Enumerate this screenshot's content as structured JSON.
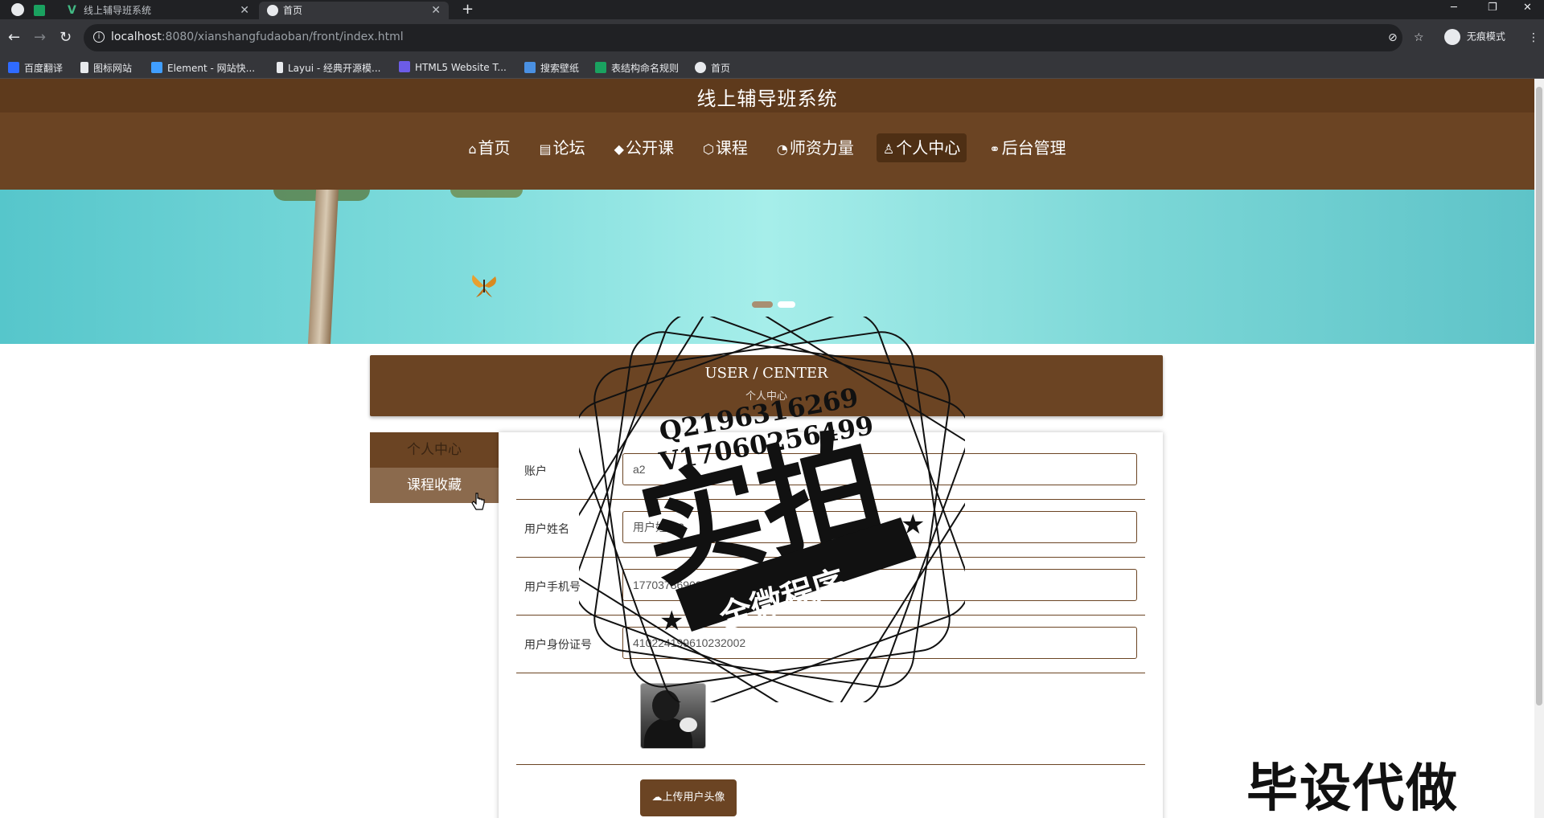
{
  "browser": {
    "tabs": [
      {
        "title": "",
        "icon": "globe-icon"
      },
      {
        "title": "",
        "icon": "sheet-icon"
      },
      {
        "title": "线上辅导班系统",
        "icon": "vue-icon"
      },
      {
        "title": "首页",
        "icon": "globe-icon"
      }
    ],
    "url_host": "localhost",
    "url_rest": ":8080/xianshangfudaoban/front/index.html",
    "incognito_label": "无痕模式",
    "bookmarks": [
      {
        "label": "百度翻译",
        "icon": "translate-icon",
        "color": "#2f6bff"
      },
      {
        "label": "图标网站",
        "icon": "flag-icon",
        "color": "#e8eaed"
      },
      {
        "label": "Element - 网站快...",
        "icon": "element-icon",
        "color": "#409eff"
      },
      {
        "label": "Layui - 经典开源模...",
        "icon": "layui-icon",
        "color": "#e8eaed"
      },
      {
        "label": "HTML5 Website T...",
        "icon": "html5-icon",
        "color": "#6c5ce7"
      },
      {
        "label": "搜索壁纸",
        "icon": "wallpaper-icon",
        "color": "#4a90e2"
      },
      {
        "label": "表结构命名规则",
        "icon": "sheet-icon",
        "color": "#1aa260"
      },
      {
        "label": "首页",
        "icon": "globe-icon",
        "color": "#e8eaed"
      }
    ]
  },
  "site": {
    "title": "线上辅导班系统",
    "nav": [
      {
        "label": "首页",
        "icon": "⌂",
        "active": false
      },
      {
        "label": "论坛",
        "icon": "▤",
        "active": false
      },
      {
        "label": "公开课",
        "icon": "◆",
        "active": false
      },
      {
        "label": "课程",
        "icon": "⬡",
        "active": false
      },
      {
        "label": "师资力量",
        "icon": "◔",
        "active": false
      },
      {
        "label": "个人中心",
        "icon": "♙",
        "active": true
      },
      {
        "label": "后台管理",
        "icon": "⚭",
        "active": false
      }
    ]
  },
  "user_center": {
    "title": "USER / CENTER",
    "subtitle": "个人中心",
    "side_menu": [
      "个人中心",
      "课程收藏"
    ],
    "fields": [
      {
        "label": "账户",
        "value": "a2"
      },
      {
        "label": "用户姓名",
        "value": "用户姓名2"
      },
      {
        "label": "用户手机号",
        "value": "17703786902"
      },
      {
        "label": "用户身份证号",
        "value": "410224199610232002"
      }
    ],
    "upload_label": "上传用户头像"
  },
  "watermark": {
    "qq": "Q2196316269",
    "vx": "V17060256499",
    "big": "实拍",
    "ribbon": "全微程序",
    "corner": "毕设代做"
  },
  "colors": {
    "brand_brown": "#6b4423",
    "banner_cyan": "#7fdcdc"
  }
}
